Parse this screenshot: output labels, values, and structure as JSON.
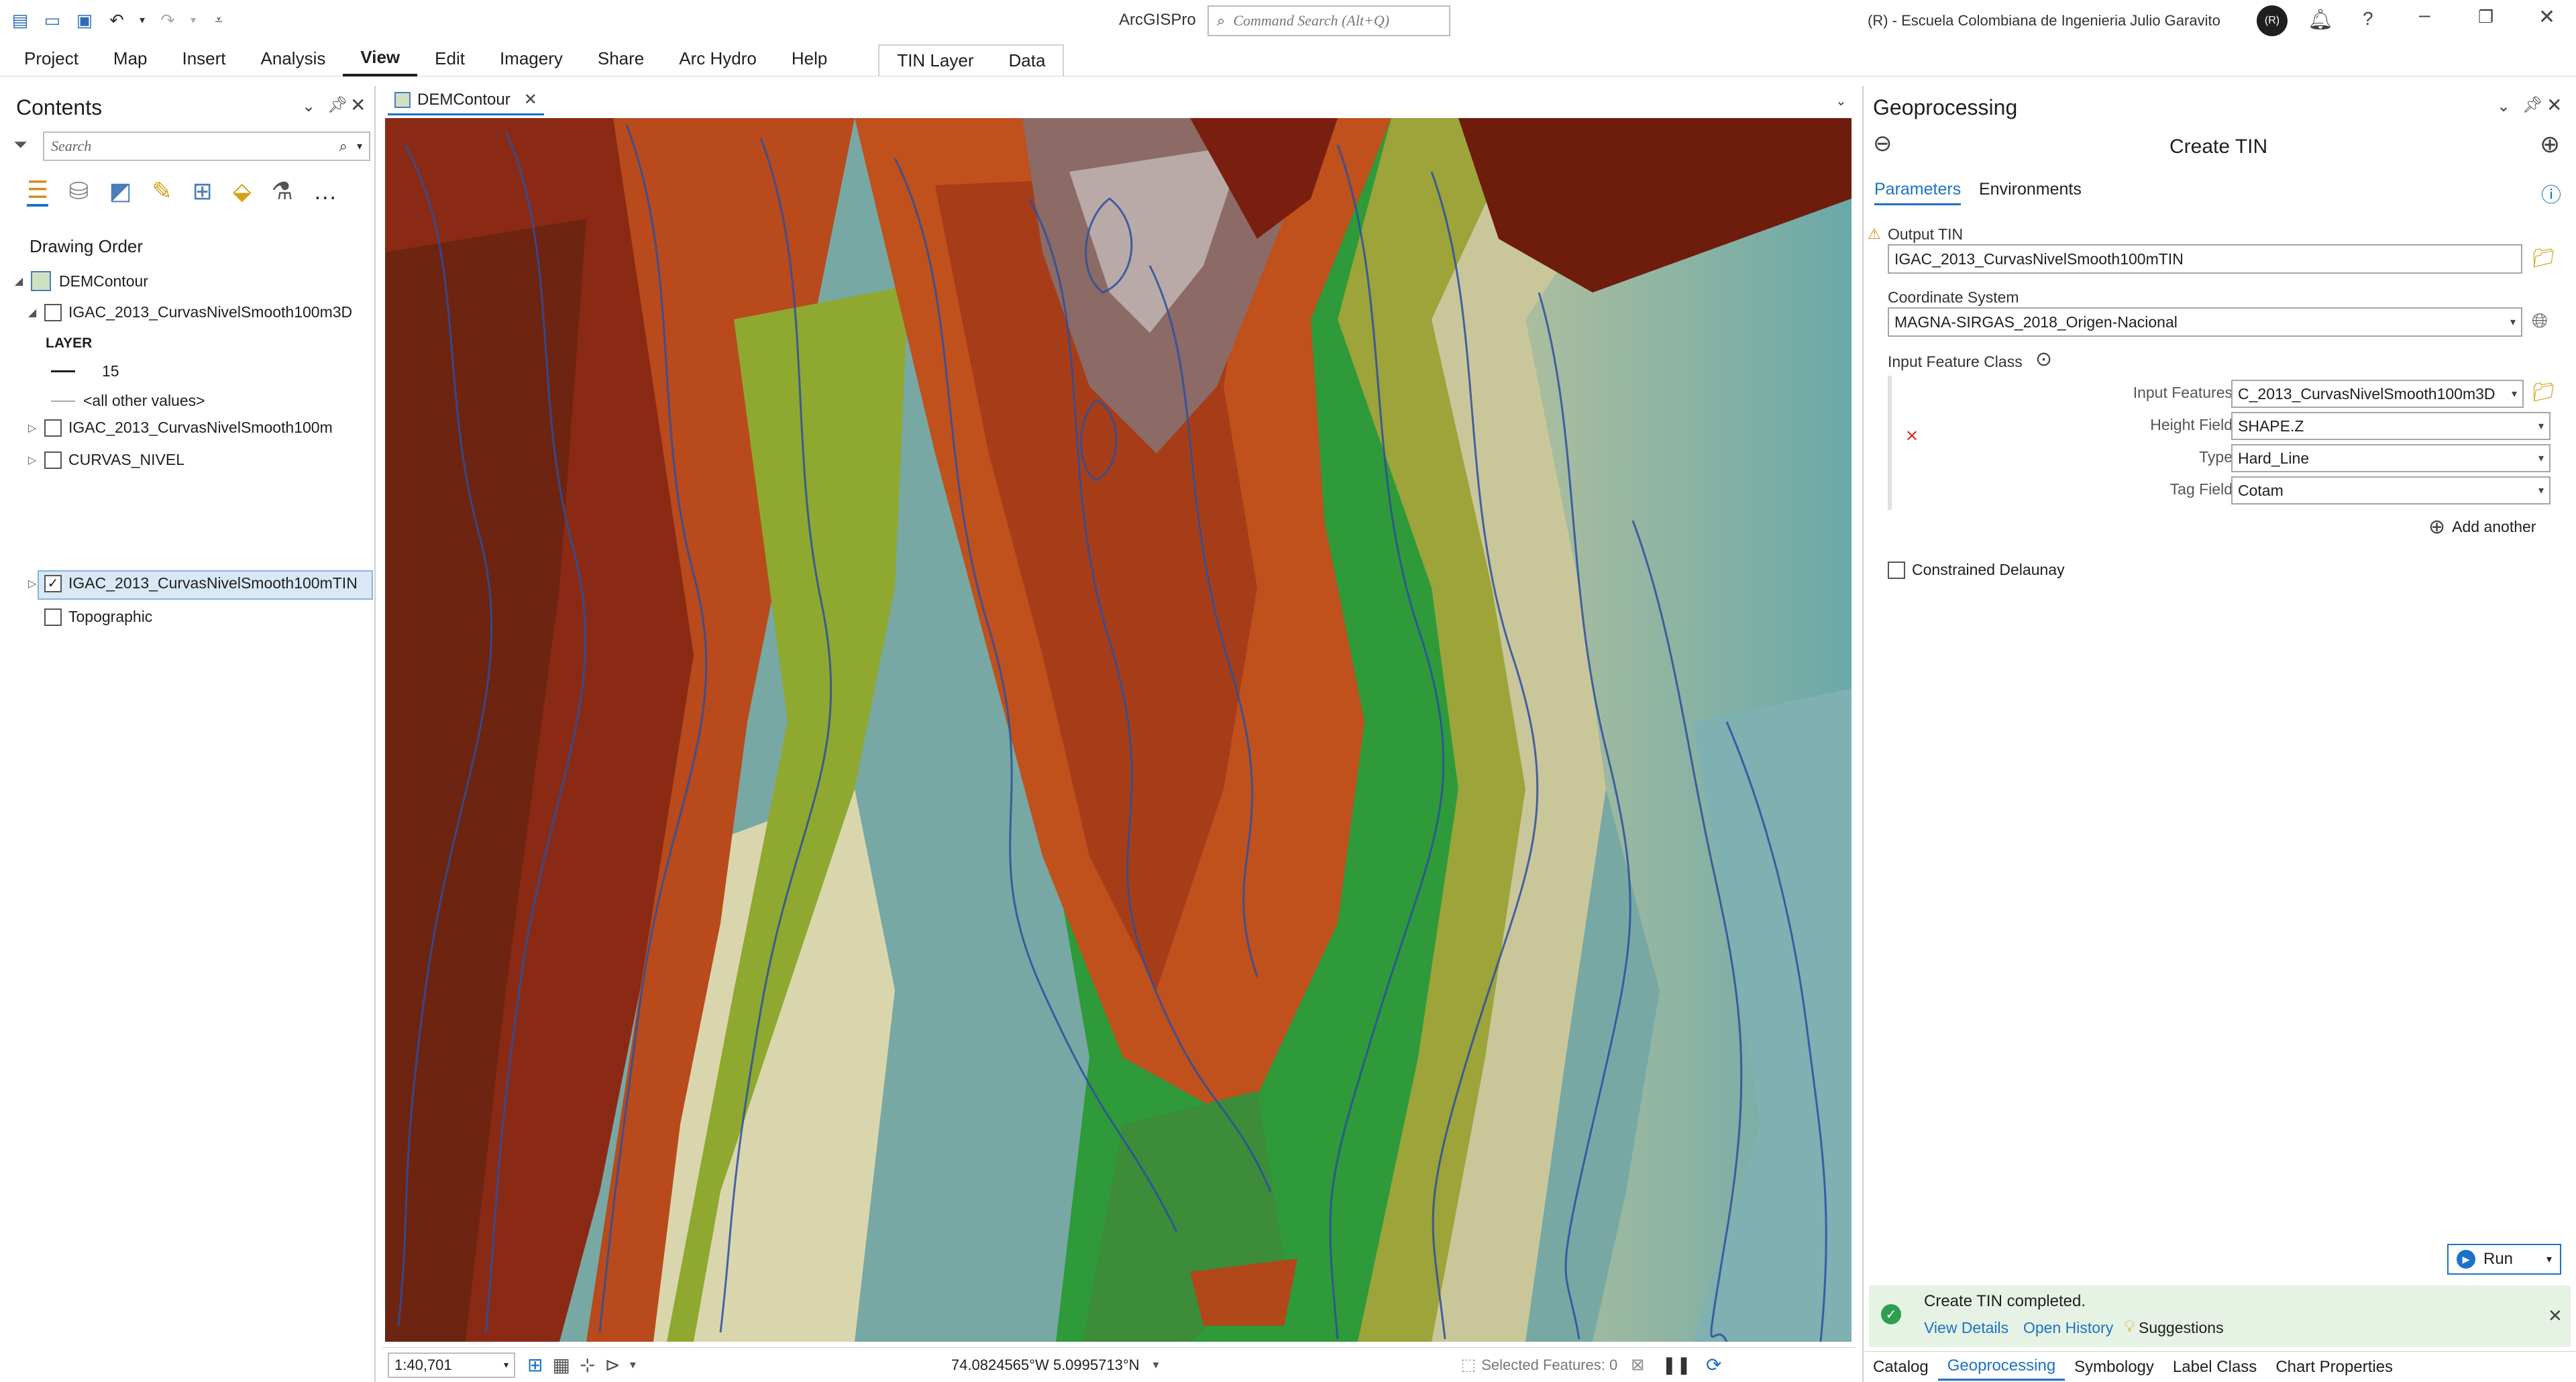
{
  "app": {
    "title": "ArcGISPro",
    "command_search_placeholder": "Command Search (Alt+Q)",
    "user": "(R) - Escuela Colombiana de Ingenieria Julio Garavito",
    "avatar_initials": "(R)"
  },
  "ribbon": {
    "tabs": [
      "Project",
      "Map",
      "Insert",
      "Analysis",
      "View",
      "Edit",
      "Imagery",
      "Share",
      "Arc Hydro",
      "Help"
    ],
    "active_tab": "View",
    "contextual_tabs": [
      "TIN Layer",
      "Data"
    ]
  },
  "contents": {
    "title": "Contents",
    "search_placeholder": "Search",
    "section": "Drawing Order",
    "map_name": "DEMContour",
    "layers": [
      {
        "name": "IGAC_2013_CurvasNivelSmooth100m3D",
        "checked": false,
        "expanded": true
      },
      {
        "name": "IGAC_2013_CurvasNivelSmooth100m",
        "checked": false,
        "expanded": false
      },
      {
        "name": "CURVAS_NIVEL",
        "checked": false,
        "expanded": false
      },
      {
        "name": "IGAC_2013_CurvasNivelSmooth100mTIN",
        "checked": true,
        "expanded": false,
        "selected": true
      },
      {
        "name": "Topographic",
        "checked": false,
        "expanded": false
      }
    ],
    "legend": {
      "heading": "LAYER",
      "value": "15",
      "other": "<all other values>"
    }
  },
  "map": {
    "tab_label": "DEMContour",
    "scale": "1:40,701",
    "coordinates": "74.0824565°W 5.0995713°N",
    "selected_features": "Selected Features: 0"
  },
  "geoprocessing": {
    "title": "Geoprocessing",
    "tool_name": "Create TIN",
    "tabs": [
      "Parameters",
      "Environments"
    ],
    "output_tin_label": "Output TIN",
    "output_tin_value": "IGAC_2013_CurvasNivelSmooth100mTIN",
    "coord_system_label": "Coordinate System",
    "coord_system_value": "MAGNA-SIRGAS_2018_Origen-Nacional",
    "input_feature_class_label": "Input Feature Class",
    "input_features_label": "Input Features",
    "input_features_value": "C_2013_CurvasNivelSmooth100m3D",
    "height_field_label": "Height Field",
    "height_field_value": "SHAPE.Z",
    "type_label": "Type",
    "type_value": "Hard_Line",
    "tag_field_label": "Tag Field",
    "tag_field_value": "Cotam",
    "add_another": "Add another",
    "constrained_delaunay": "Constrained Delaunay",
    "run_label": "Run",
    "status_message": "Create TIN completed.",
    "view_details": "View Details",
    "open_history": "Open History",
    "suggestions": "Suggestions"
  },
  "bottom_tabs": [
    "Catalog",
    "Geoprocessing",
    "Symbology",
    "Label Class",
    "Chart Properties"
  ],
  "bottom_active": "Geoprocessing",
  "colors": {
    "accent": "#1a73c7",
    "success": "#2e9e4f",
    "selected_row": "#d9e8f6"
  }
}
